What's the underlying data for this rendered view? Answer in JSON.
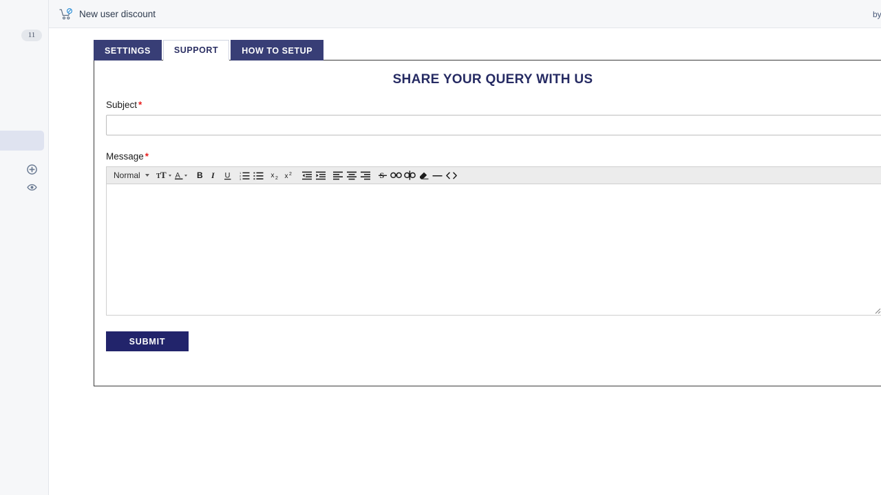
{
  "sidebar": {
    "badge_count": "11",
    "icons": [
      {
        "name": "add-circle-icon"
      },
      {
        "name": "eye-icon"
      }
    ]
  },
  "promo_bar": {
    "icon": "shopping-cart-icon",
    "text": "New user discount",
    "right_text": "by"
  },
  "tabs": [
    {
      "label": "SETTINGS",
      "active": false
    },
    {
      "label": "SUPPORT",
      "active": true
    },
    {
      "label": "HOW TO SETUP",
      "active": false
    }
  ],
  "card": {
    "title": "SHARE YOUR QUERY WITH US",
    "fields": {
      "subject": {
        "label": "Subject",
        "required_marker": "*",
        "value": "",
        "placeholder": ""
      },
      "message": {
        "label": "Message",
        "required_marker": "*",
        "value": "",
        "placeholder": ""
      }
    },
    "submit_label": "SUBMIT"
  },
  "editor_toolbar": {
    "block_format": "Normal",
    "buttons": [
      {
        "name": "font-size-picker",
        "title": "Size"
      },
      {
        "name": "font-color-picker",
        "title": "Color"
      },
      {
        "name": "bold-button",
        "title": "B"
      },
      {
        "name": "italic-button",
        "title": "I"
      },
      {
        "name": "underline-button",
        "title": "U"
      },
      {
        "name": "ordered-list-button",
        "title": "Ordered list"
      },
      {
        "name": "bullet-list-button",
        "title": "Bullet list"
      },
      {
        "name": "subscript-button",
        "title": "x2"
      },
      {
        "name": "superscript-button",
        "title": "x2"
      },
      {
        "name": "indent-decrease-button",
        "title": "Outdent"
      },
      {
        "name": "indent-increase-button",
        "title": "Indent"
      },
      {
        "name": "align-left-button",
        "title": "Align left"
      },
      {
        "name": "align-center-button",
        "title": "Align center"
      },
      {
        "name": "align-right-button",
        "title": "Align right"
      },
      {
        "name": "strikethrough-button",
        "title": "S"
      },
      {
        "name": "link-button",
        "title": "Link"
      },
      {
        "name": "unlink-button",
        "title": "Unlink"
      },
      {
        "name": "clean-format-button",
        "title": "Clear formatting"
      },
      {
        "name": "horizontal-rule-button",
        "title": "Divider"
      },
      {
        "name": "code-button",
        "title": "Code"
      }
    ]
  },
  "colors": {
    "tab_active_text": "#2b2f63",
    "tab_inactive_bg": "#383e76",
    "title_text": "#262b63",
    "submit_bg": "#22246b",
    "required_red": "#e8201f",
    "toolbar_bg": "#ececec",
    "rail_bg": "#f6f7f9",
    "rail_active": "#dfe3f0"
  }
}
